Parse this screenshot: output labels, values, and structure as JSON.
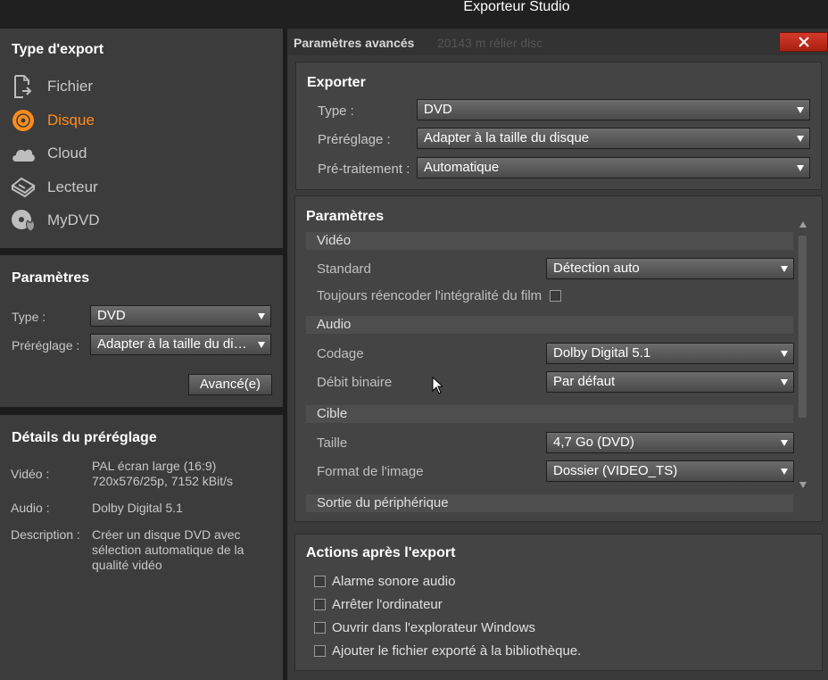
{
  "window": {
    "title": "Exporteur Studio"
  },
  "export_type": {
    "title": "Type d'export",
    "items": [
      {
        "label": "Fichier",
        "icon": "file-export-icon",
        "active": false
      },
      {
        "label": "Disque",
        "icon": "disc-icon",
        "active": true
      },
      {
        "label": "Cloud",
        "icon": "cloud-icon",
        "active": false
      },
      {
        "label": "Lecteur",
        "icon": "device-icon",
        "active": false
      },
      {
        "label": "MyDVD",
        "icon": "mydvd-icon",
        "active": false
      }
    ]
  },
  "params": {
    "title": "Paramètres",
    "type_label": "Type :",
    "type_value": "DVD",
    "preset_label": "Préréglage :",
    "preset_value": "Adapter à la taille du disque",
    "advanced_button": "Avancé(e)"
  },
  "preset_details": {
    "title": "Détails du préréglage",
    "video_label": "Vidéo :",
    "video_value": "PAL écran large (16:9) 720x576/25p, 7152 kBit/s",
    "audio_label": "Audio :",
    "audio_value": "Dolby Digital 5.1",
    "description_label": "Description :",
    "description_value": "Créer un disque DVD avec sélection automatique de la qualité vidéo"
  },
  "advanced": {
    "title": "Paramètres avancés",
    "background_text": "20143 m  rélier disc",
    "export": {
      "title": "Exporter",
      "type_label": "Type :",
      "type_value": "DVD",
      "preset_label": "Préréglage :",
      "preset_value": "Adapter à la taille du disque",
      "preprocess_label": "Pré-traitement :",
      "preprocess_value": "Automatique"
    },
    "settings": {
      "title": "Paramètres",
      "video_section": "Vidéo",
      "standard_label": "Standard",
      "standard_value": "Détection auto",
      "reencode_label": "Toujours réencoder l'intégralité du film",
      "audio_section": "Audio",
      "codec_label": "Codage",
      "codec_value": "Dolby Digital 5.1",
      "bitrate_label": "Débit binaire",
      "bitrate_value": "Par défaut",
      "target_section": "Cible",
      "size_label": "Taille",
      "size_value": "4,7 Go (DVD)",
      "image_format_label": "Format de l'image",
      "image_format_value": "Dossier (VIDEO_TS)",
      "device_output_section": "Sortie du périphérique"
    },
    "post_actions": {
      "title": "Actions après l'export",
      "items": [
        "Alarme sonore audio",
        "Arrêter l'ordinateur",
        "Ouvrir dans l'explorateur Windows",
        "Ajouter le fichier exporté à la bibliothèque."
      ]
    }
  },
  "colors": {
    "accent": "#ff8c1a",
    "close": "#c0301f"
  }
}
